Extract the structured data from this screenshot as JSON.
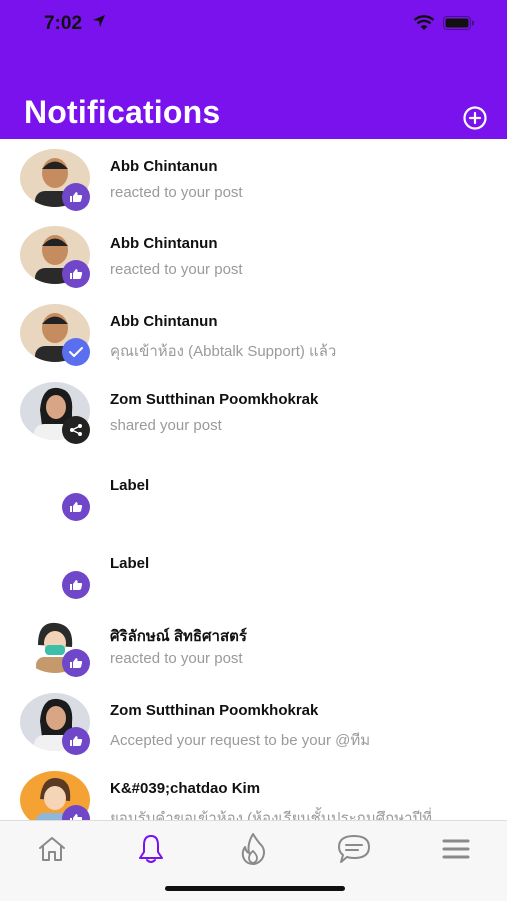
{
  "status_bar": {
    "time": "7:02"
  },
  "header": {
    "title": "Notifications",
    "add_icon": "plus-circle-icon"
  },
  "notifications": [
    {
      "name": "Abb Chintanun",
      "text": "reacted to your post",
      "badge": "like-icon"
    },
    {
      "name": "Abb Chintanun",
      "text": "reacted to your post",
      "badge": "like-icon"
    },
    {
      "name": "Abb Chintanun",
      "text": "คุณเข้าห้อง (Abbtalk Support) แล้ว",
      "badge": "check-icon"
    },
    {
      "name": "Zom Sutthinan Poomkhokrak",
      "text": "shared your post",
      "badge": "share-icon"
    },
    {
      "name": "Label",
      "text": "",
      "badge": "like-icon"
    },
    {
      "name": "Label",
      "text": "",
      "badge": "like-icon"
    },
    {
      "name": "ศิริลักษณ์ สิทธิศาสตร์",
      "text": "reacted to your post",
      "badge": "like-icon"
    },
    {
      "name": "Zom Sutthinan Poomkhokrak",
      "text": "Accepted your request to be your @ทีม",
      "badge": "like-icon"
    },
    {
      "name": "K&#039;chatdao Kim",
      "text": "ยอมรับคำขอเข้าห้อง (ห้องเรียนชั้นประถมศึกษาปีที่...",
      "badge": "like-icon"
    }
  ],
  "tabbar": {
    "items": [
      "home-icon",
      "bell-icon",
      "flame-icon",
      "chat-icon",
      "menu-icon"
    ],
    "active": "bell-icon",
    "active_color": "#7a12ee",
    "inactive_color": "#8a8a8a"
  },
  "colors": {
    "header": "#7a12ee",
    "badge_like": "#7047c9",
    "badge_check": "#5a6ff0"
  }
}
